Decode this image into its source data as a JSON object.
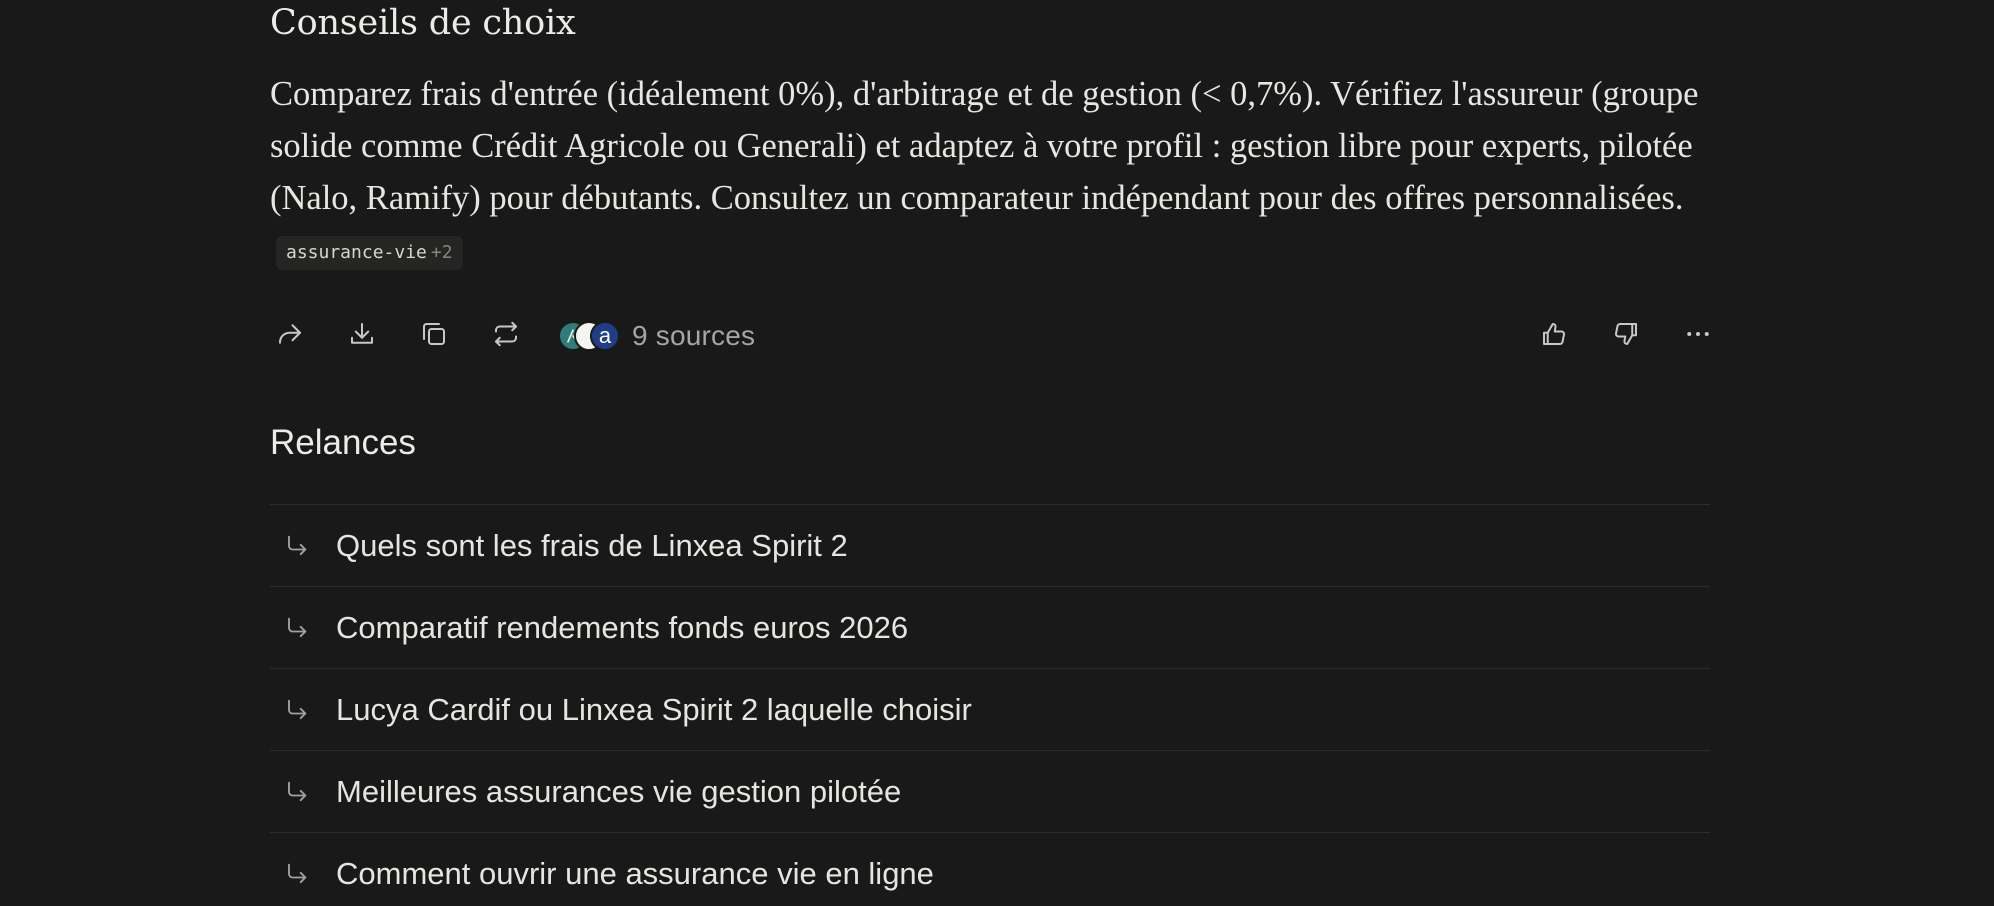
{
  "answer": {
    "section_heading": "Conseils de choix",
    "paragraph": "Comparez frais d'entrée (idéalement 0%), d'arbitrage et de gestion (< 0,7%). Vérifiez l'assureur (groupe solide comme Crédit Agricole ou Generali) et adaptez à votre profil : gestion libre pour experts, pilotée (Nalo, Ramify) pour débutants. Consultez un comparateur indépendant pour des offres personnalisées.",
    "tag": {
      "label": "assurance-vie",
      "more": "+2"
    }
  },
  "actions": {
    "icons": [
      "share-icon",
      "download-icon",
      "copy-icon",
      "rewrite-icon",
      "thumbs-up-icon",
      "thumbs-down-icon",
      "more-icon"
    ],
    "sources": {
      "favicon_letters": [
        "",
        "",
        "a"
      ],
      "label": "9 sources"
    }
  },
  "related": {
    "heading": "Relances",
    "items": [
      {
        "label": "Quels sont les frais de Linxea Spirit 2"
      },
      {
        "label": "Comparatif rendements fonds euros 2026"
      },
      {
        "label": "Lucya Cardif ou Linxea Spirit 2 laquelle choisir"
      },
      {
        "label": "Meilleures assurances vie gestion pilotée"
      },
      {
        "label": "Comment ouvrir une assurance vie en ligne"
      }
    ]
  },
  "colors": {
    "background": "#191919",
    "text": "#e8e8e3",
    "muted": "#a6a59f",
    "divider": "#2c2c2b"
  }
}
